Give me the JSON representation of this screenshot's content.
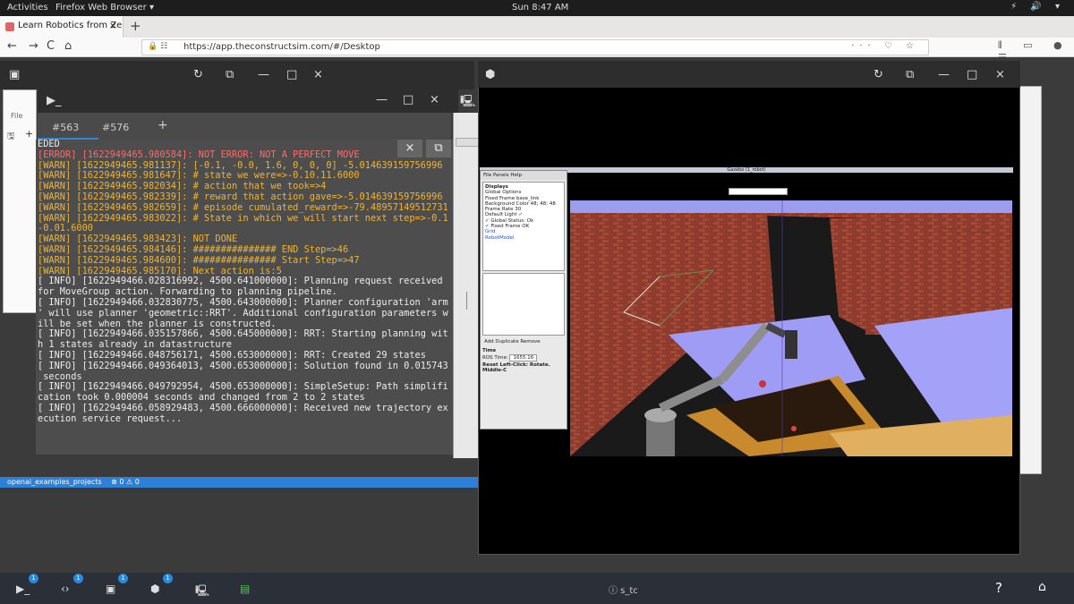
{
  "gnome": {
    "activities": "Activities",
    "app_name": "Firefox Web Browser ▾",
    "clock": "Sun  8:47 AM",
    "tray": "⚡ 🔊 ▾"
  },
  "browser": {
    "tab_title": "Learn Robotics from Zer",
    "url": "https://app.theconstructsim.com/#/Desktop",
    "new_tab": "+"
  },
  "terminal": {
    "tabs": [
      "#563",
      "#576"
    ],
    "add_tab": "+",
    "lines": [
      {
        "cls": "info",
        "text": "EDED"
      },
      {
        "cls": "err",
        "text": "[ERROR] [1622949465.980584]: NOT ERROR: NOT A PERFECT MOVE"
      },
      {
        "cls": "warn",
        "text": "[WARN] [1622949465.981137]: [-0.1, -0.0, 1.6, 0, 0, 0] -5.014639159756996"
      },
      {
        "cls": "warn",
        "text": "[WARN] [1622949465.981647]: # state we were=>-0.10.11.6000"
      },
      {
        "cls": "warn",
        "text": "[WARN] [1622949465.982034]: # action that we took=>4"
      },
      {
        "cls": "warn",
        "text": "[WARN] [1622949465.982339]: # reward that action gave=>-5.014639159756996"
      },
      {
        "cls": "warn",
        "text": "[WARN] [1622949465.982659]: # episode cumulated_reward=>-79.48957149512731"
      },
      {
        "cls": "warn",
        "text": "[WARN] [1622949465.983022]: # State in which we will start next step=>-0.1"
      },
      {
        "cls": "warn",
        "text": "-0.01.6000"
      },
      {
        "cls": "warn",
        "text": "[WARN] [1622949465.983423]: NOT DONE"
      },
      {
        "cls": "warn",
        "text": "[WARN] [1622949465.984146]: ############### END Step=>46"
      },
      {
        "cls": "warn",
        "text": "[WARN] [1622949465.984600]: ############### Start Step=>47"
      },
      {
        "cls": "warn",
        "text": "[WARN] [1622949465.985170]: Next action is:5"
      },
      {
        "cls": "info",
        "text": "[ INFO] [1622949466.028316992, 4500.641000000]: Planning request received"
      },
      {
        "cls": "info",
        "text": "for MoveGroup action. Forwarding to planning pipeline."
      },
      {
        "cls": "info",
        "text": "[ INFO] [1622949466.032830775, 4500.643000000]: Planner configuration 'arm"
      },
      {
        "cls": "info",
        "text": "' will use planner 'geometric::RRT'. Additional configuration parameters w"
      },
      {
        "cls": "info",
        "text": "ill be set when the planner is constructed."
      },
      {
        "cls": "info",
        "text": "[ INFO] [1622949466.035157866, 4500.645000000]: RRT: Starting planning wit"
      },
      {
        "cls": "info",
        "text": "h 1 states already in datastructure"
      },
      {
        "cls": "info",
        "text": "[ INFO] [1622949466.048756171, 4500.653000000]: RRT: Created 29 states"
      },
      {
        "cls": "info",
        "text": "[ INFO] [1622949466.049364013, 4500.653000000]: Solution found in 0.015743"
      },
      {
        "cls": "info",
        "text": " seconds"
      },
      {
        "cls": "info",
        "text": "[ INFO] [1622949466.049792954, 4500.653000000]: SimpleSetup: Path simplifi"
      },
      {
        "cls": "info",
        "text": "cation took 0.000004 seconds and changed from 2 to 2 states"
      },
      {
        "cls": "info",
        "text": "[ INFO] [1622949466.058929483, 4500.666000000]: Received new trajectory ex"
      },
      {
        "cls": "info",
        "text": "ecution service request..."
      }
    ]
  },
  "left_strip": {
    "menu": "File"
  },
  "status_bar": {
    "project": "openai_examples_projects",
    "problems": "⊗ 0 ⚠ 0"
  },
  "rviz": {
    "title": "Gazebo (1_robot)",
    "menu": "File   Panels   Help",
    "displays_header": "Displays",
    "items": [
      "Global Options",
      "Fixed Frame   base_link",
      "Background Color  48; 48; 48",
      "Frame Rate   30",
      "Default Light   ✓",
      "✓ Global Status: Ok",
      "  ✓ Fixed Frame   OK",
      "Grid",
      "RobotModel"
    ],
    "buttons": "Add    Duplicate    Remove",
    "time_header": "Time",
    "ros_time_label": "ROS Time:",
    "ros_time_value": "1655.16",
    "footer": "Reset   Left-Click: Rotate. Middle-C"
  },
  "dock": {
    "badges": [
      "1",
      "1",
      "1",
      "1"
    ],
    "center": "ⓘ  s_tc",
    "help": "?",
    "home": "⌂"
  },
  "colors": {
    "accent": "#2e88d8",
    "warn": "#f0b430",
    "error": "#ff6a6a"
  }
}
